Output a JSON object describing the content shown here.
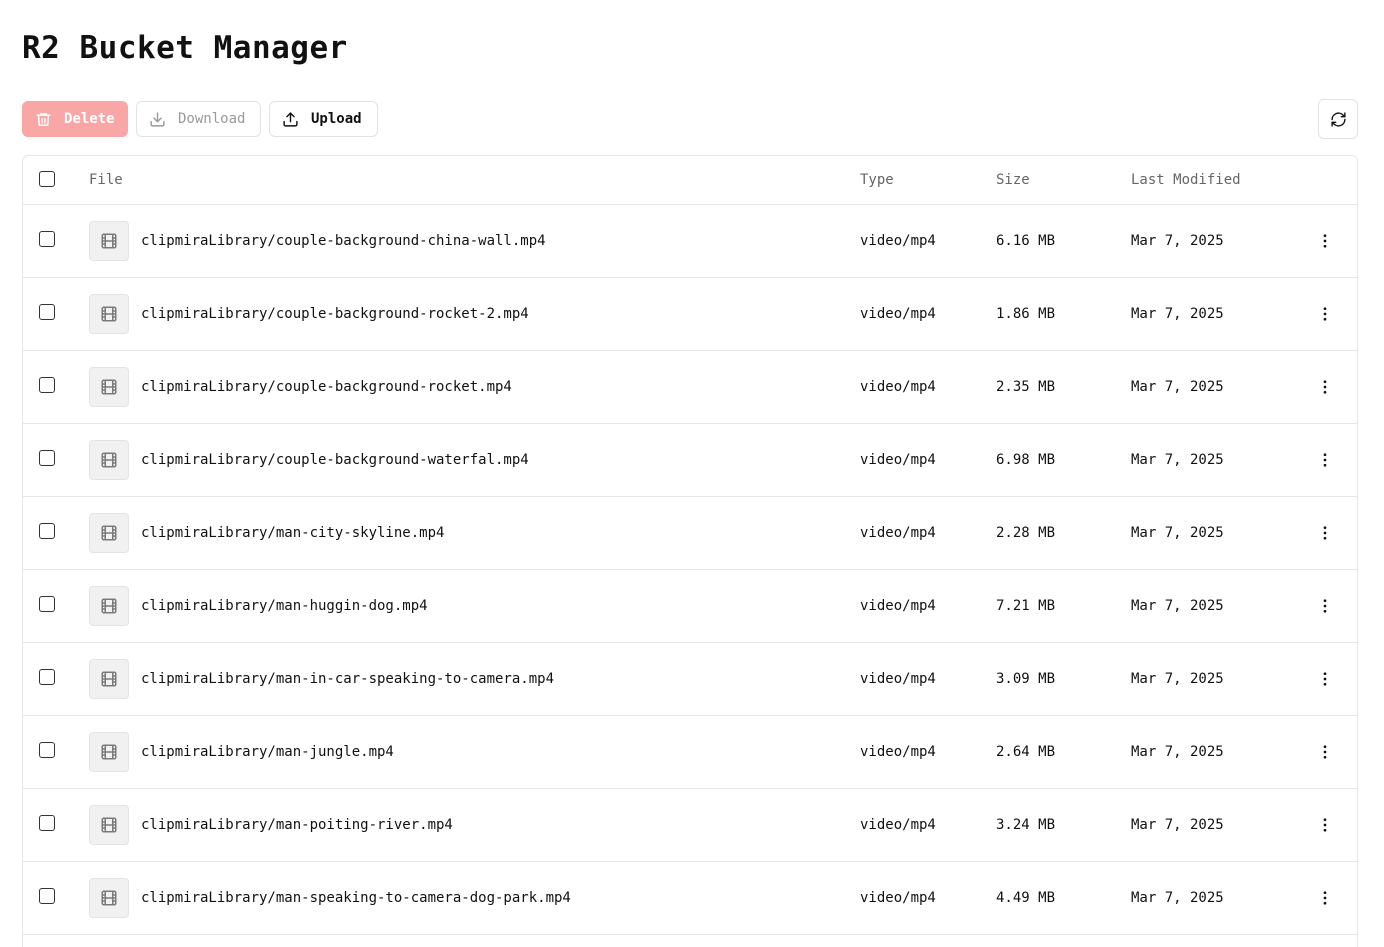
{
  "app": {
    "title": "R2 Bucket Manager"
  },
  "toolbar": {
    "delete_label": "Delete",
    "download_label": "Download",
    "upload_label": "Upload",
    "delete_icon": "trash-icon",
    "download_icon": "download-icon",
    "upload_icon": "upload-icon",
    "refresh_icon": "refresh-icon"
  },
  "colors": {
    "delete_bg": "#f8a6a6",
    "border": "#e6e6e6",
    "header_text": "#666666"
  },
  "table": {
    "columns": {
      "file": "File",
      "type": "Type",
      "size": "Size",
      "modified": "Last Modified"
    },
    "rows": [
      {
        "name": "clipmiraLibrary/couple-background-china-wall.mp4",
        "type": "video/mp4",
        "size": "6.16 MB",
        "modified": "Mar 7, 2025"
      },
      {
        "name": "clipmiraLibrary/couple-background-rocket-2.mp4",
        "type": "video/mp4",
        "size": "1.86 MB",
        "modified": "Mar 7, 2025"
      },
      {
        "name": "clipmiraLibrary/couple-background-rocket.mp4",
        "type": "video/mp4",
        "size": "2.35 MB",
        "modified": "Mar 7, 2025"
      },
      {
        "name": "clipmiraLibrary/couple-background-waterfal.mp4",
        "type": "video/mp4",
        "size": "6.98 MB",
        "modified": "Mar 7, 2025"
      },
      {
        "name": "clipmiraLibrary/man-city-skyline.mp4",
        "type": "video/mp4",
        "size": "2.28 MB",
        "modified": "Mar 7, 2025"
      },
      {
        "name": "clipmiraLibrary/man-huggin-dog.mp4",
        "type": "video/mp4",
        "size": "7.21 MB",
        "modified": "Mar 7, 2025"
      },
      {
        "name": "clipmiraLibrary/man-in-car-speaking-to-camera.mp4",
        "type": "video/mp4",
        "size": "3.09 MB",
        "modified": "Mar 7, 2025"
      },
      {
        "name": "clipmiraLibrary/man-jungle.mp4",
        "type": "video/mp4",
        "size": "2.64 MB",
        "modified": "Mar 7, 2025"
      },
      {
        "name": "clipmiraLibrary/man-poiting-river.mp4",
        "type": "video/mp4",
        "size": "3.24 MB",
        "modified": "Mar 7, 2025"
      },
      {
        "name": "clipmiraLibrary/man-speaking-to-camera-dog-park.mp4",
        "type": "video/mp4",
        "size": "4.49 MB",
        "modified": "Mar 7, 2025"
      }
    ]
  }
}
